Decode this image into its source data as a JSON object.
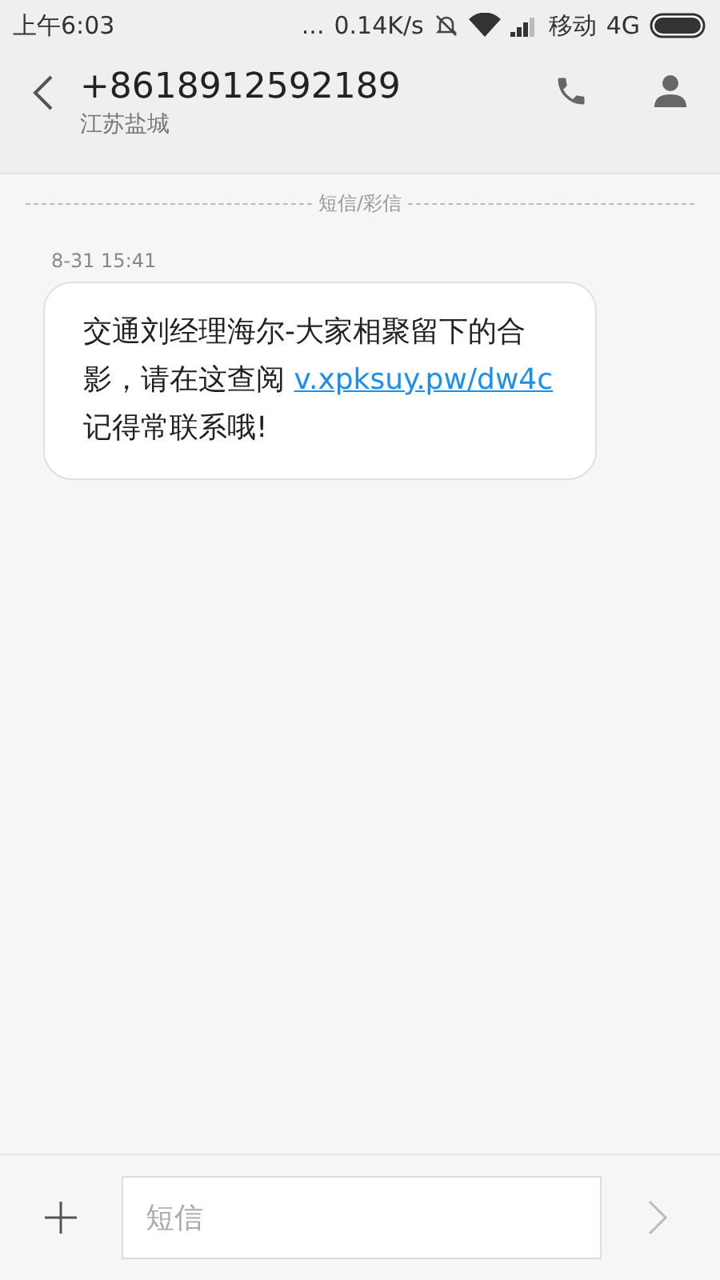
{
  "status_bar": {
    "time": "上午6:03",
    "dots": "...",
    "speed": "0.14K/s",
    "carrier": "移动",
    "network": "4G"
  },
  "header": {
    "title": "+8618912592189",
    "subtitle": "江苏盐城"
  },
  "divider_label": "短信/彩信",
  "messages": [
    {
      "time": "8-31 15:41",
      "text_before": "交通刘经理海尔-大家相聚留下的合影，请在这查阅 ",
      "link": "v.xpksuy.pw/dw4c",
      "text_after": "记得常联系哦!"
    }
  ],
  "composer": {
    "placeholder": "短信"
  }
}
